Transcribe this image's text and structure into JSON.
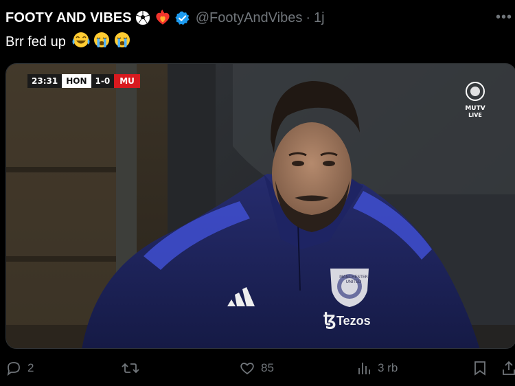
{
  "tweet": {
    "display_name": "FOOTY AND VIBES",
    "handle": "@FootyAndVibes",
    "separator": "·",
    "time": "1j",
    "text": "Brr fed up",
    "name_badges": [
      "soccer-ball-icon",
      "fire-heart-icon",
      "verified-badge-icon"
    ],
    "text_emojis": [
      "laughing-crying-emoji",
      "loudly-crying-emoji",
      "loudly-crying-emoji"
    ]
  },
  "media": {
    "scorebug": {
      "time": "23:31",
      "home": "HON",
      "score": "1-0",
      "away": "MU"
    },
    "broadcaster": {
      "line1": "MUTV",
      "line2": "LIVE"
    },
    "sponsor": "Tezos",
    "crest_text": "MANCHESTER UNITED"
  },
  "actions": {
    "replies": "2",
    "reposts": "",
    "likes": "85",
    "views": "3 rb"
  },
  "colors": {
    "background": "#000000",
    "secondary_text": "#71767b",
    "verified": "#1d9bf0",
    "jacket": "#1b1f4f",
    "scorebug_red": "#d81a1f"
  }
}
